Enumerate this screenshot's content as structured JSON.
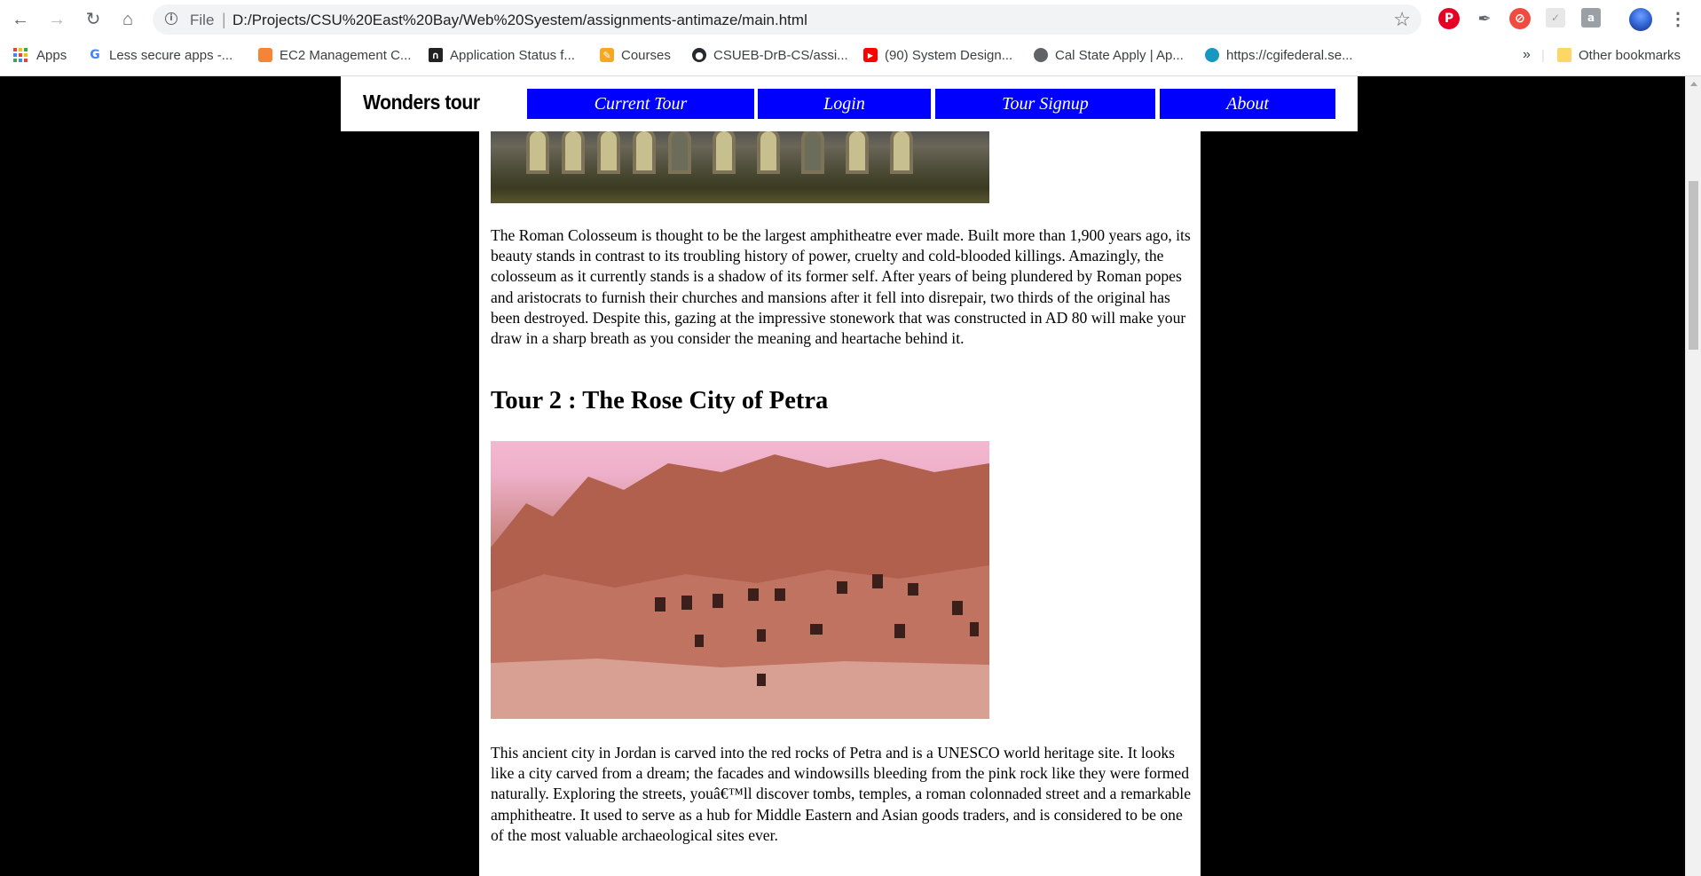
{
  "browser": {
    "url_scheme": "File",
    "url": "D:/Projects/CSU%20East%20Bay/Web%20Syestem/assignments-antimaze/main.html",
    "bookmarks": [
      {
        "label": "Apps",
        "icon": "apps-grid-icon"
      },
      {
        "label": "Less secure apps -...",
        "icon": "google-icon"
      },
      {
        "label": "EC2 Management C...",
        "icon": "aws-cube-icon"
      },
      {
        "label": "Application Status f...",
        "icon": "university-icon"
      },
      {
        "label": "Courses",
        "icon": "pencil-icon"
      },
      {
        "label": "CSUEB-DrB-CS/assi...",
        "icon": "github-icon"
      },
      {
        "label": "(90) System Design...",
        "icon": "youtube-icon"
      },
      {
        "label": "Cal State Apply | Ap...",
        "icon": "globe-icon"
      },
      {
        "label": "https://cgifederal.se...",
        "icon": "salesforce-cloud-icon"
      }
    ],
    "overflow_label": "»",
    "other_bookmarks": "Other bookmarks"
  },
  "site": {
    "logo": "Wonders tour",
    "nav": [
      {
        "label": "Current Tour"
      },
      {
        "label": "Login"
      },
      {
        "label": "Tour Signup"
      },
      {
        "label": "About"
      }
    ],
    "nav_color": "#0000ff"
  },
  "content": {
    "tour1_paragraph": "The Roman Colosseum is thought to be the largest amphitheatre ever made. Built more than 1,900 years ago, its beauty stands in contrast to its troubling history of power, cruelty and cold-blooded killings. Amazingly, the colosseum as it currently stands is a shadow of its former self. After years of being plundered by Roman popes and aristocrats to furnish their churches and mansions after it fell into disrepair, two thirds of the original has been destroyed. Despite this, gazing at the impressive stonework that was constructed in AD 80 will make your draw in a sharp breath as you consider the meaning and heartache behind it.",
    "tour2_heading": "Tour 2 : The Rose City of Petra",
    "tour2_paragraph": "This ancient city in Jordan is carved into the red rocks of Petra and is a UNESCO world heritage site. It looks like a city carved from a dream; the facades and windowsills bleeding from the pink rock like they were formed naturally. Exploring the streets, youâ€™ll discover tombs, temples, a roman colonnaded street and a remarkable amphitheatre. It used to serve as a hub for Middle Eastern and Asian goods traders, and is considered to be one of the most valuable archaeological sites ever."
  }
}
